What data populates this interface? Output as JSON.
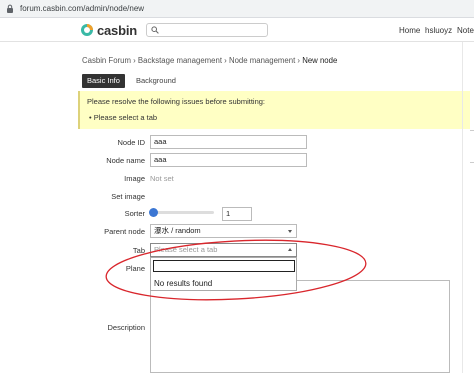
{
  "browser": {
    "url": "forum.casbin.com/admin/node/new"
  },
  "header": {
    "logo_text": "casbin",
    "nav": {
      "home": "Home",
      "user": "hsluoyz",
      "notes": "Notes"
    }
  },
  "breadcrumb": {
    "items": [
      "Casbin Forum",
      "Backstage management",
      "Node management"
    ],
    "separator": " › ",
    "current": "New node"
  },
  "tabs": [
    {
      "label": "Basic Info",
      "active": true
    },
    {
      "label": "Background",
      "active": false
    }
  ],
  "alert": {
    "message": "Please resolve the following issues before submitting:",
    "issues": [
      "Please select a tab"
    ]
  },
  "form": {
    "node_id": {
      "label": "Node ID",
      "value": "aaa"
    },
    "node_name": {
      "label": "Node name",
      "value": "aaa"
    },
    "image": {
      "label": "Image",
      "value": "Not set"
    },
    "set_image": {
      "label": "Set image"
    },
    "sorter": {
      "label": "Sorter",
      "value": "1",
      "slider_fraction": 0.0
    },
    "parent_node": {
      "label": "Parent node",
      "value": "瀑水 / random"
    },
    "tab": {
      "label": "Tab",
      "placeholder": "Please select a tab",
      "search_value": "",
      "no_results": "No results found"
    },
    "plane": {
      "label": "Plane"
    },
    "description": {
      "label": "Description"
    }
  },
  "colors": {
    "annotation": "#d9262c",
    "active_tab": "#333333",
    "alert_bg": "#ffffc4",
    "slider": "#3b76d3"
  },
  "icons": [
    "lock-icon",
    "casbin-logo-icon",
    "search-icon",
    "chevron-down-icon"
  ]
}
